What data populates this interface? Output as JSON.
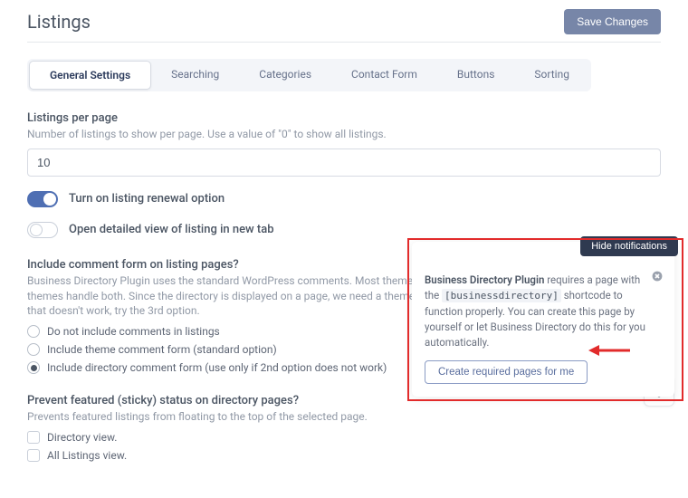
{
  "header": {
    "title": "Listings",
    "save_label": "Save Changes"
  },
  "tabs": [
    {
      "label": "General Settings",
      "active": true
    },
    {
      "label": "Searching",
      "active": false
    },
    {
      "label": "Categories",
      "active": false
    },
    {
      "label": "Contact Form",
      "active": false
    },
    {
      "label": "Buttons",
      "active": false
    },
    {
      "label": "Sorting",
      "active": false
    }
  ],
  "listings_per_page": {
    "label": "Listings per page",
    "desc": "Number of listings to show per page. Use a value of \"0\" to show all listings.",
    "value": "10"
  },
  "toggles": {
    "renewal": {
      "label": "Turn on listing renewal option",
      "on": true
    },
    "new_tab": {
      "label": "Open detailed view of listing in new tab",
      "on": false
    }
  },
  "comments": {
    "heading": "Include comment form on listing pages?",
    "desc": "Business Directory Plugin uses the standard WordPress comments. Most themes allow for comments on posts, not pages. Some themes handle both. Since the directory is displayed on a page, we need a theme that can handle both. Use the 2nd option first, if that doesn't work, try the 3rd option.",
    "options": [
      "Do not include comments in listings",
      "Include theme comment form (standard option)",
      "Include directory comment form (use only if 2nd option does not work)"
    ],
    "selected_index": 2
  },
  "sticky": {
    "heading": "Prevent featured (sticky) status on directory pages?",
    "desc": "Prevents featured listings from floating to the top of the selected page.",
    "options": [
      "Directory view.",
      "All Listings view."
    ]
  },
  "notification": {
    "hide_label": "Hide notifications",
    "strong_lead": "Business Directory Plugin",
    "text_1": " requires a page with the ",
    "shortcode": "[businessdirectory]",
    "text_2": " shortcode to function properly. You can create this page by yourself or let Business Directory do this for you automatically.",
    "button_label": "Create required pages for me"
  }
}
